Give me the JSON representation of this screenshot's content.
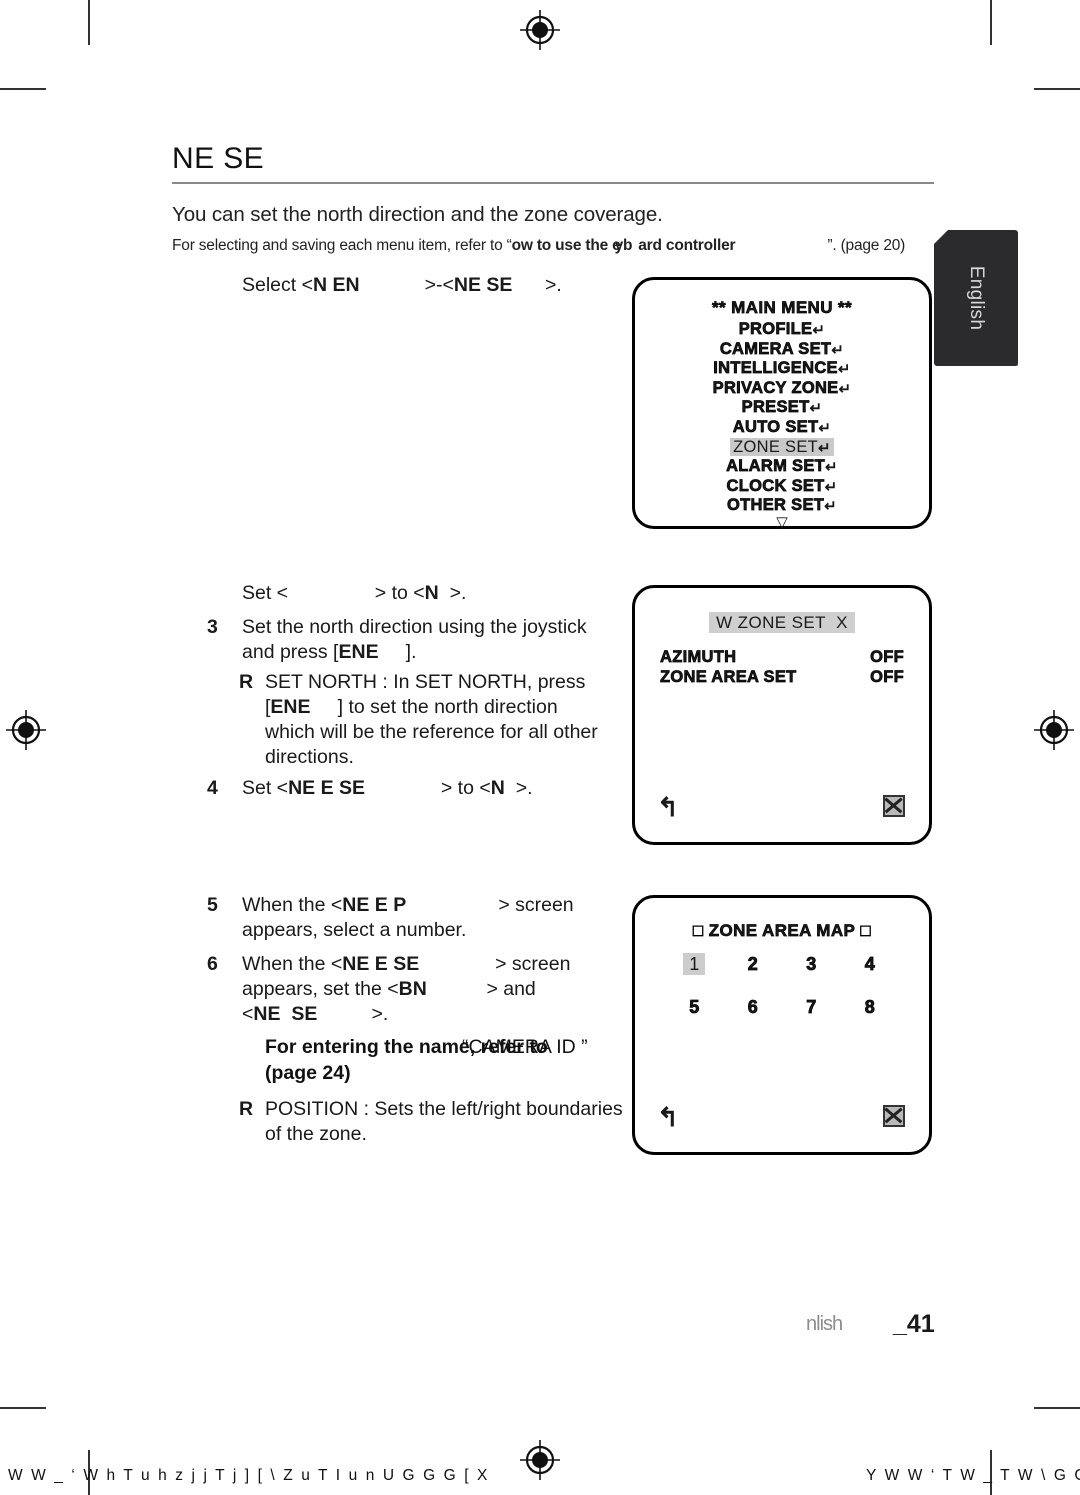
{
  "document": {
    "heading": "NE SE",
    "lead": "You can set the north direction and the zone coverage.",
    "subnote": {
      "prefix": "For selecting and saving each menu item, refer to “",
      "bold": "ow to use the e",
      "overlap": "yb",
      "bold_tail": "ard controller",
      "suffix": "”. (page 20)"
    },
    "side_tab": "English",
    "footer": {
      "language": "nlish",
      "page": "_41"
    },
    "printer_marks": {
      "bottom_left": "W W _ ‘ W h T u h  z j j T j ] [ \\ Z u T I u n U     G G G [ X",
      "bottom_right": "Y W W ‘ T W _ T W \\ G G"
    }
  },
  "steps": [
    {
      "name": "select-menu-step",
      "num": "",
      "lines": [
        {
          "parts": [
            {
              "t": "Select <",
              "b": false
            },
            {
              "t": "N EN",
              "b": true
            },
            {
              "t": "            >-<",
              "b": false
            },
            {
              "t": "NE SE",
              "b": true
            },
            {
              "t": "      >.",
              "b": false
            }
          ]
        }
      ]
    },
    {
      "name": "set-azimuth-step",
      "num": "",
      "lines": [
        {
          "parts": [
            {
              "t": "Set <",
              "b": false
            },
            {
              "t": "                ",
              "b": true
            },
            {
              "t": "> to <",
              "b": false
            },
            {
              "t": "N",
              "b": true
            },
            {
              "t": "  >.",
              "b": false
            }
          ]
        }
      ]
    },
    {
      "name": "set-north-direction-step",
      "num": "3",
      "lines": [
        {
          "parts": [
            {
              "t": "Set the north direction using the joystick",
              "b": false
            }
          ]
        },
        {
          "parts": [
            {
              "t": "and press [",
              "b": false
            },
            {
              "t": "ENE",
              "b": true
            },
            {
              "t": "     ].",
              "b": false
            }
          ]
        }
      ]
    },
    {
      "name": "set-zone-area-set-step",
      "num": "4",
      "lines": [
        {
          "parts": [
            {
              "t": "Set <",
              "b": false
            },
            {
              "t": "NE E SE",
              "b": true
            },
            {
              "t": "              > to <",
              "b": false
            },
            {
              "t": "N",
              "b": true
            },
            {
              "t": "  >.",
              "b": false
            }
          ]
        }
      ]
    },
    {
      "name": "zone-area-map-step",
      "num": "5",
      "lines": [
        {
          "parts": [
            {
              "t": "When the <",
              "b": false
            },
            {
              "t": "NE E P",
              "b": true
            },
            {
              "t": "                 > screen",
              "b": false
            }
          ]
        },
        {
          "parts": [
            {
              "t": "appears, select a number.",
              "b": false
            }
          ]
        }
      ]
    },
    {
      "name": "zone-setup-step",
      "num": "6",
      "lines": [
        {
          "parts": [
            {
              "t": "When the <",
              "b": false
            },
            {
              "t": "NE E SE",
              "b": true
            },
            {
              "t": "              > screen",
              "b": false
            }
          ]
        },
        {
          "parts": [
            {
              "t": "appears, set the <",
              "b": false
            },
            {
              "t": "B",
              "b": true
            },
            {
              "t": "N",
              "b": true
            },
            {
              "t": "           > and",
              "b": false
            }
          ]
        },
        {
          "parts": [
            {
              "t": "<",
              "b": false
            },
            {
              "t": "NE  SE",
              "b": true
            },
            {
              "t": "          >.",
              "b": false
            }
          ]
        }
      ]
    }
  ],
  "bullets": [
    {
      "name": "set-north-note",
      "marker": "R",
      "lines": [
        {
          "parts": [
            {
              "t": "SET NORTH : In SET NORTH, press",
              "b": false
            }
          ]
        },
        {
          "parts": [
            {
              "t": "[",
              "b": false
            },
            {
              "t": "ENE",
              "b": true
            },
            {
              "t": "     ] to set the north direction",
              "b": false
            }
          ]
        },
        {
          "parts": [
            {
              "t": "which will be the reference for all other",
              "b": false
            }
          ]
        },
        {
          "parts": [
            {
              "t": "directions.",
              "b": false
            }
          ]
        }
      ]
    },
    {
      "name": "position-note",
      "marker": "R",
      "lines": [
        {
          "parts": [
            {
              "t": "POSITION : Sets the left/right boundaries",
              "b": false
            }
          ]
        },
        {
          "parts": [
            {
              "t": "of the zone.",
              "b": false
            }
          ]
        }
      ]
    }
  ],
  "note_bold": {
    "line1": "For entering the name, refer to",
    "ghost": "“CAMERA ID ”",
    "line2": "(page 24)"
  },
  "osd_panels": [
    {
      "name": "main-menu-osd",
      "title": "** MAIN MENU **",
      "items": [
        {
          "label": "PROFILE",
          "enter": "↵",
          "selected": false
        },
        {
          "label": "CAMERA SET",
          "enter": "↵",
          "selected": false
        },
        {
          "label": "INTELLIGENCE",
          "enter": "↵",
          "selected": false
        },
        {
          "label": "PRIVACY ZONE",
          "enter": "↵",
          "selected": false
        },
        {
          "label": "PRESET",
          "enter": "↵",
          "selected": false
        },
        {
          "label": "AUTO SET",
          "enter": "↵",
          "selected": false
        },
        {
          "label": "ZONE SET",
          "enter": "↵",
          "selected": true
        },
        {
          "label": "ALARM SET",
          "enter": "↵",
          "selected": false
        },
        {
          "label": "CLOCK SET",
          "enter": "↵",
          "selected": false
        },
        {
          "label": "OTHER SET",
          "enter": "↵",
          "selected": false
        }
      ],
      "more_caret": "▽"
    },
    {
      "name": "zone-set-osd",
      "title_prefix": "W",
      "title": "ZONE SET",
      "title_suffix": "X",
      "rows": [
        {
          "label": "AZIMUTH",
          "value": "OFF"
        },
        {
          "label": "ZONE AREA SET",
          "value": "OFF"
        }
      ],
      "back_icon": "↰",
      "close_icon": "close-box"
    },
    {
      "name": "zone-area-map-osd",
      "title_prefix": "□",
      "title": "ZONE AREA MAP",
      "title_suffix": "□",
      "cells": [
        {
          "label": "1",
          "selected": true
        },
        {
          "label": "2",
          "selected": false
        },
        {
          "label": "3",
          "selected": false
        },
        {
          "label": "4",
          "selected": false
        },
        {
          "label": "5",
          "selected": false
        },
        {
          "label": "6",
          "selected": false
        },
        {
          "label": "7",
          "selected": false
        },
        {
          "label": "8",
          "selected": false
        }
      ],
      "back_icon": "↰",
      "close_icon": "close-box"
    }
  ]
}
